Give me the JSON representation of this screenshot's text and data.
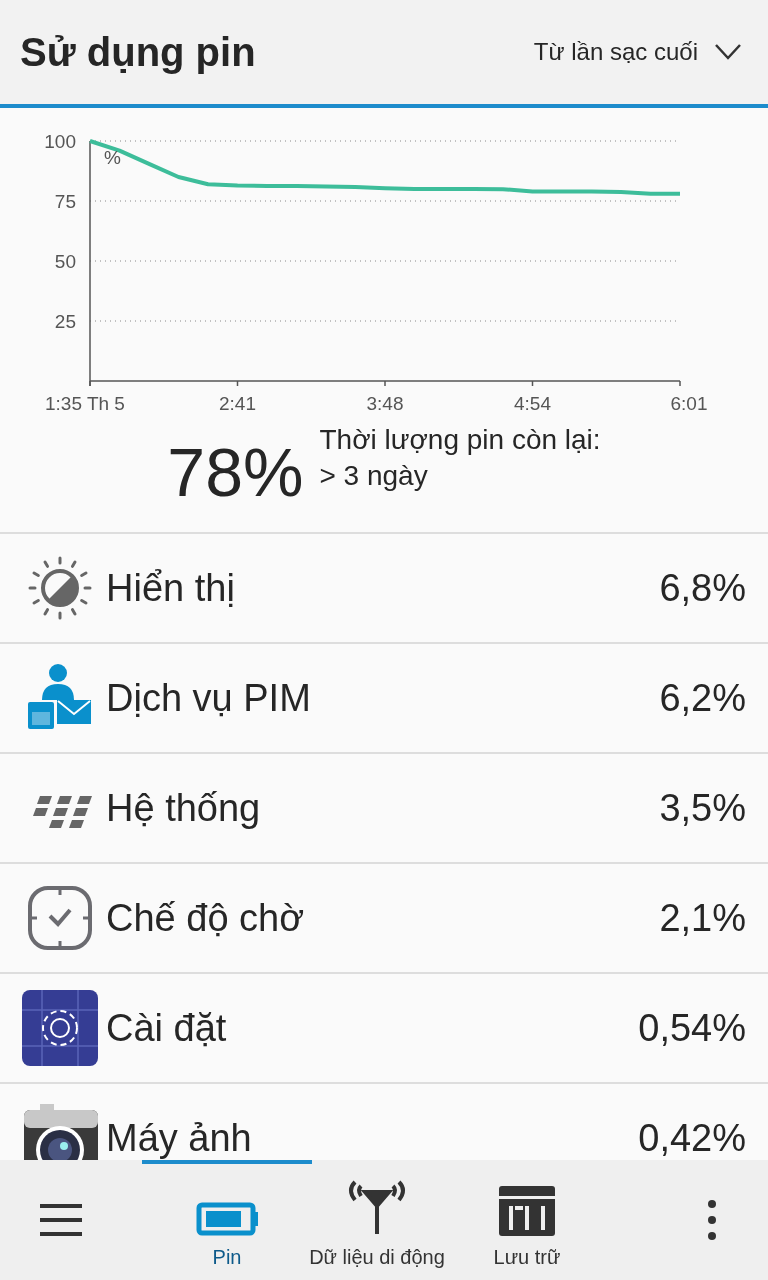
{
  "header": {
    "title": "Sử dụng pin",
    "range": "Từ lần sạc cuối"
  },
  "chart_data": {
    "type": "line",
    "ylabel": "%",
    "grid": true,
    "categories": [
      "1:35 Th 5",
      null,
      null,
      null,
      null,
      "2:41",
      null,
      null,
      null,
      null,
      "3:48",
      null,
      null,
      null,
      null,
      "4:54",
      null,
      null,
      null,
      null,
      "6:01"
    ],
    "series": [
      {
        "color": "#3dbd9a",
        "values": [
          100,
          96,
          90.5,
          85,
          82,
          81.4,
          81.3,
          81.2,
          81.1,
          80.8,
          80.3,
          80,
          80,
          80,
          79.9,
          79,
          79,
          79,
          78.7,
          78,
          78
        ]
      }
    ],
    "ylim": [
      0,
      100
    ],
    "yticks": [
      25,
      50,
      75,
      100
    ]
  },
  "summary": {
    "percent": "78%",
    "label": "Thời lượng pin còn lại:",
    "value": "> 3 ngày"
  },
  "items": [
    {
      "kind": "brightness",
      "name": "Hiển thị",
      "value": "6,8%"
    },
    {
      "kind": "pim",
      "name": "Dịch vụ PIM",
      "value": "6,2%"
    },
    {
      "kind": "system",
      "name": "Hệ thống",
      "value": "3,5%"
    },
    {
      "kind": "standby",
      "name": "Chế độ chờ",
      "value": "2,1%"
    },
    {
      "kind": "settings",
      "name": "Cài đặt",
      "value": "0,54%"
    },
    {
      "kind": "camera",
      "name": "Máy ảnh",
      "value": "0,42%"
    }
  ],
  "tabs": [
    {
      "kind": "battery",
      "label": "Pin",
      "selected": true
    },
    {
      "kind": "antenna",
      "label": "Dữ liệu di động",
      "selected": false
    },
    {
      "kind": "storage",
      "label": "Lưu trữ",
      "selected": false
    }
  ]
}
